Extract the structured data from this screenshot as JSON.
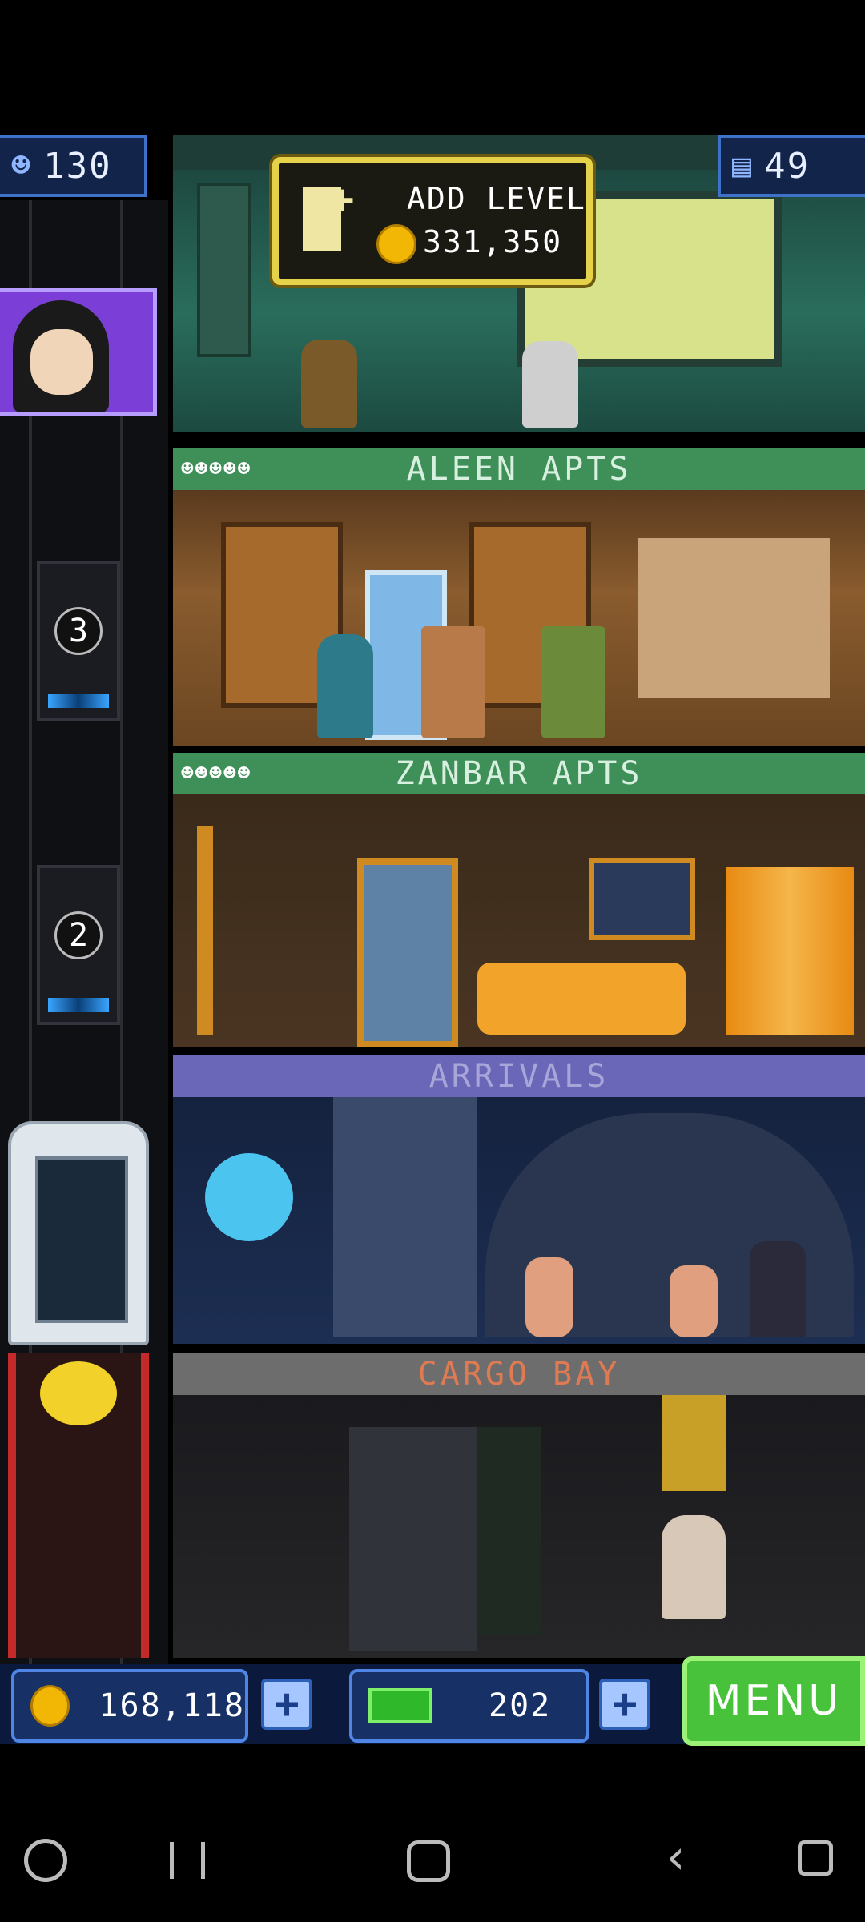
{
  "hud": {
    "population": "130",
    "floors": "49"
  },
  "add_level": {
    "title": "ADD LEVEL",
    "cost": "331,350"
  },
  "floors": [
    {
      "name": "ALEEN APTS",
      "type": "residential"
    },
    {
      "name": "ZANBAR APTS",
      "type": "residential"
    },
    {
      "name": "ARRIVALS",
      "type": "lobby"
    },
    {
      "name": "CARGO BAY",
      "type": "cargo"
    }
  ],
  "elevator": {
    "car_numbers": [
      "3",
      "2"
    ]
  },
  "currency": {
    "coins": "168,118",
    "bux": "202"
  },
  "menu": {
    "label": "MENU"
  },
  "colors": {
    "residential_bar": "#3f8f58",
    "lobby_bar": "#6a66b8",
    "cargo_bar": "#6d6d6d",
    "menu_green": "#47c23a",
    "coin_gold": "#f2b705"
  },
  "icons": [
    "person-icon",
    "floors-icon",
    "coin-icon",
    "bux-icon",
    "plus-icon",
    "games-icon",
    "recent-apps-icon",
    "home-icon",
    "back-icon",
    "assistant-icon"
  ]
}
